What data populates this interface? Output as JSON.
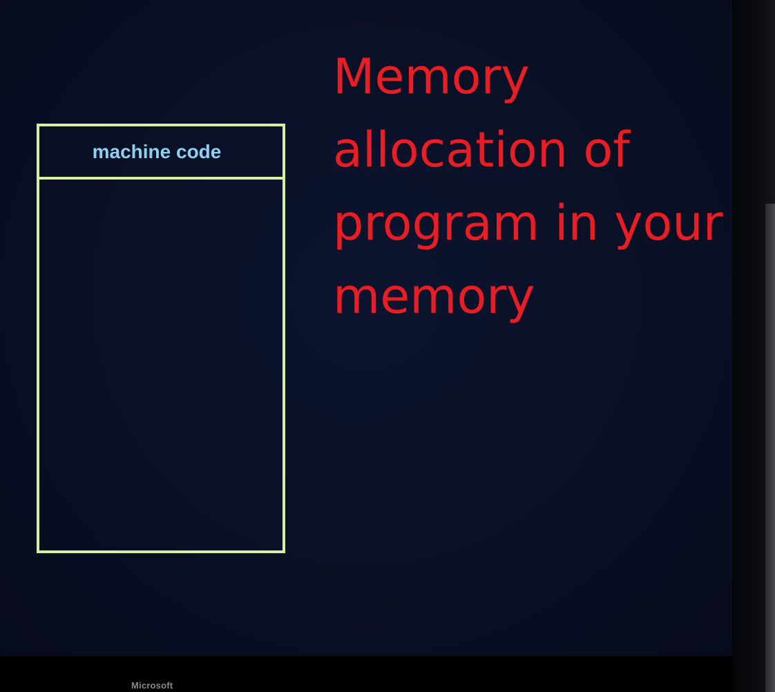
{
  "diagram": {
    "caption": "Memory allocation of program in your memory",
    "memory_block": {
      "segments": [
        {
          "label": "machine code"
        },
        {
          "label": ""
        }
      ],
      "outline_color": "#d7f0a0",
      "label_color": "#8fd0ef"
    }
  },
  "caption_color": "#e81e24",
  "monitor": {
    "brand": "Microsoft"
  }
}
